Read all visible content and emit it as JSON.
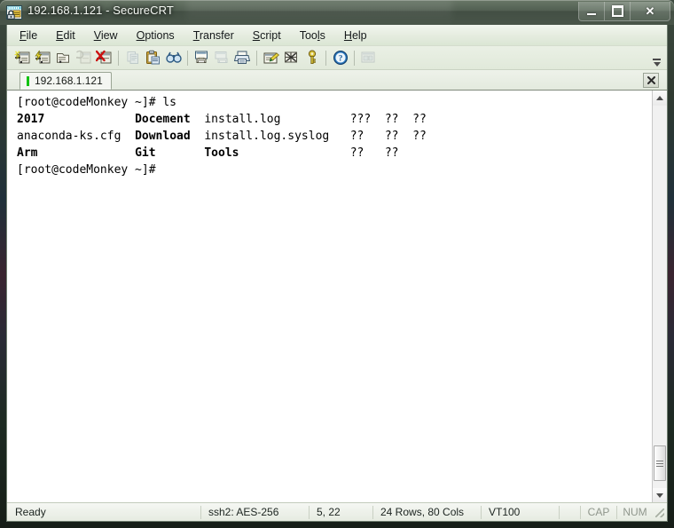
{
  "window": {
    "title": "192.168.1.121 - SecureCRT",
    "icon": "securecrt-lock-icon",
    "caption": {
      "minimize_label": "Minimize",
      "maximize_label": "Maximize",
      "close_label": "Close"
    }
  },
  "menubar": {
    "items": [
      {
        "label": "File",
        "accel": "F"
      },
      {
        "label": "Edit",
        "accel": "E"
      },
      {
        "label": "View",
        "accel": "V"
      },
      {
        "label": "Options",
        "accel": "O"
      },
      {
        "label": "Transfer",
        "accel": "T"
      },
      {
        "label": "Script",
        "accel": "S"
      },
      {
        "label": "Tools",
        "accel": "l"
      },
      {
        "label": "Help",
        "accel": "H"
      }
    ]
  },
  "toolbar": {
    "buttons": [
      {
        "name": "connect-icon",
        "enabled": true
      },
      {
        "name": "quick-connect-icon",
        "enabled": true
      },
      {
        "name": "connect-in-tab-icon",
        "enabled": true
      },
      {
        "name": "reconnect-icon",
        "enabled": false
      },
      {
        "name": "disconnect-icon",
        "enabled": true
      },
      {
        "name": "copy-icon",
        "enabled": false
      },
      {
        "name": "paste-icon",
        "enabled": true
      },
      {
        "name": "find-icon",
        "enabled": true
      },
      {
        "name": "log-session-icon",
        "enabled": true
      },
      {
        "name": "print-screen-icon",
        "enabled": false
      },
      {
        "name": "print-icon",
        "enabled": true
      },
      {
        "name": "session-options-icon",
        "enabled": true
      },
      {
        "name": "global-options-icon",
        "enabled": true
      },
      {
        "name": "key-icon",
        "enabled": true
      },
      {
        "name": "help-icon",
        "enabled": true
      },
      {
        "name": "arrange-icon",
        "enabled": false
      }
    ],
    "overflow_label": "Toolbar Options"
  },
  "tabs": {
    "items": [
      {
        "label": "192.168.1.121",
        "connected": true,
        "indicator_color": "#12c212"
      }
    ],
    "close_label": "Close session"
  },
  "terminal": {
    "rows": 24,
    "cols": 80,
    "cursor_row": 5,
    "cursor_col": 22,
    "lines": [
      {
        "type": "prompt",
        "segments": [
          {
            "text": "[root@codeMonkey ~]# ls",
            "bold": false
          }
        ]
      },
      {
        "type": "listing",
        "segments": [
          {
            "text": "2017",
            "bold": true
          },
          {
            "text": "             ",
            "bold": false
          },
          {
            "text": "Docement",
            "bold": true
          },
          {
            "text": "  ",
            "bold": false
          },
          {
            "text": "install.log          ???  ??  ??",
            "bold": false
          }
        ]
      },
      {
        "type": "listing",
        "segments": [
          {
            "text": "anaconda-ks.cfg",
            "bold": false
          },
          {
            "text": "  ",
            "bold": false
          },
          {
            "text": "Download",
            "bold": true
          },
          {
            "text": "  ",
            "bold": false
          },
          {
            "text": "install.log.syslog   ??   ??  ??",
            "bold": false
          }
        ]
      },
      {
        "type": "listing",
        "segments": [
          {
            "text": "Arm",
            "bold": true
          },
          {
            "text": "              ",
            "bold": false
          },
          {
            "text": "Git",
            "bold": true
          },
          {
            "text": "       ",
            "bold": false
          },
          {
            "text": "Tools",
            "bold": true
          },
          {
            "text": "                ??   ??",
            "bold": false
          }
        ]
      },
      {
        "type": "prompt",
        "segments": [
          {
            "text": "[root@codeMonkey ~]# ",
            "bold": false
          }
        ]
      }
    ]
  },
  "scrollbar": {
    "up_label": "Scroll up",
    "down_label": "Scroll down",
    "thumb_label": "Scroll thumb"
  },
  "statusbar": {
    "ready": "Ready",
    "cipher": "ssh2: AES-256",
    "position": "5,  22",
    "dimensions": "24 Rows,  80 Cols",
    "emulation": "VT100",
    "caps": "CAP",
    "num": "NUM"
  },
  "colors": {
    "tab_indicator": "#12c212",
    "terminal_bg": "#ffffff",
    "terminal_fg": "#000000",
    "menubar_bg": "#e5ecdf"
  }
}
